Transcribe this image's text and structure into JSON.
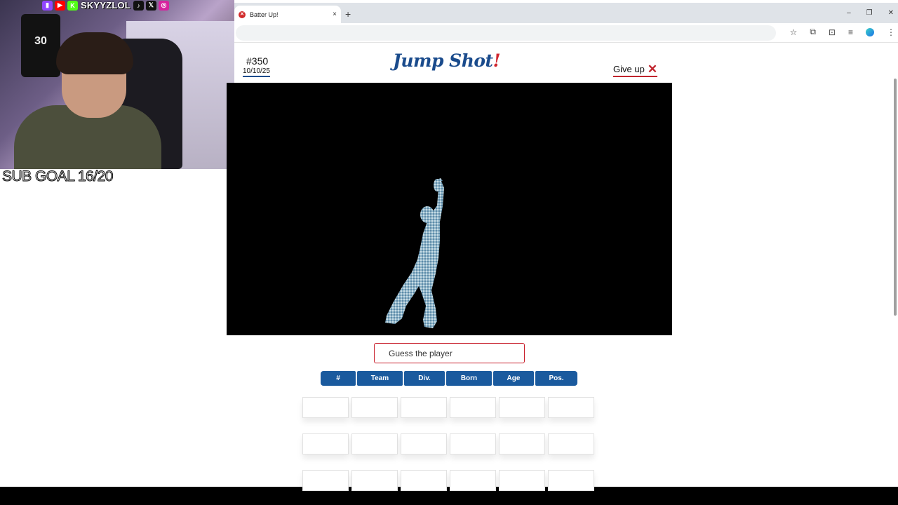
{
  "stream": {
    "social_handle": "SKYYZLOL",
    "sub_goal": "SUB GOAL 16/20",
    "jersey_number": "30",
    "social_icons": [
      {
        "name": "twitch-icon",
        "glyph": "▮",
        "color": "#9146ff"
      },
      {
        "name": "youtube-icon",
        "glyph": "▶",
        "color": "#ff0000"
      },
      {
        "name": "kick-icon",
        "glyph": "K",
        "color": "#53fc18"
      }
    ],
    "social_icons_after": [
      {
        "name": "tiktok-icon",
        "glyph": "♪",
        "color": "#111111"
      },
      {
        "name": "x-icon",
        "glyph": "𝕏",
        "color": "#111111"
      },
      {
        "name": "instagram-icon",
        "glyph": "◎",
        "color": "#d6249f"
      }
    ]
  },
  "browser": {
    "tab_title": "Batter Up!",
    "tab_close": "×",
    "new_tab": "+",
    "window_controls": [
      "–",
      "❐",
      "✕"
    ],
    "toolbar_icons": [
      "☆",
      "⧉",
      "⊡",
      "≡"
    ]
  },
  "game": {
    "number": "#350",
    "date": "10/10/25",
    "logo": "Jump Shot",
    "logo_bang": "!",
    "give_up_label": "Give up",
    "give_up_icon": "✕",
    "guess_placeholder": "Guess the player",
    "columns": [
      {
        "key": "num",
        "label": "#"
      },
      {
        "key": "team",
        "label": "Team"
      },
      {
        "key": "div",
        "label": "Div."
      },
      {
        "key": "born",
        "label": "Born"
      },
      {
        "key": "age",
        "label": "Age"
      },
      {
        "key": "pos",
        "label": "Pos."
      }
    ],
    "guess_rows": 3,
    "guess_cols": 6
  }
}
